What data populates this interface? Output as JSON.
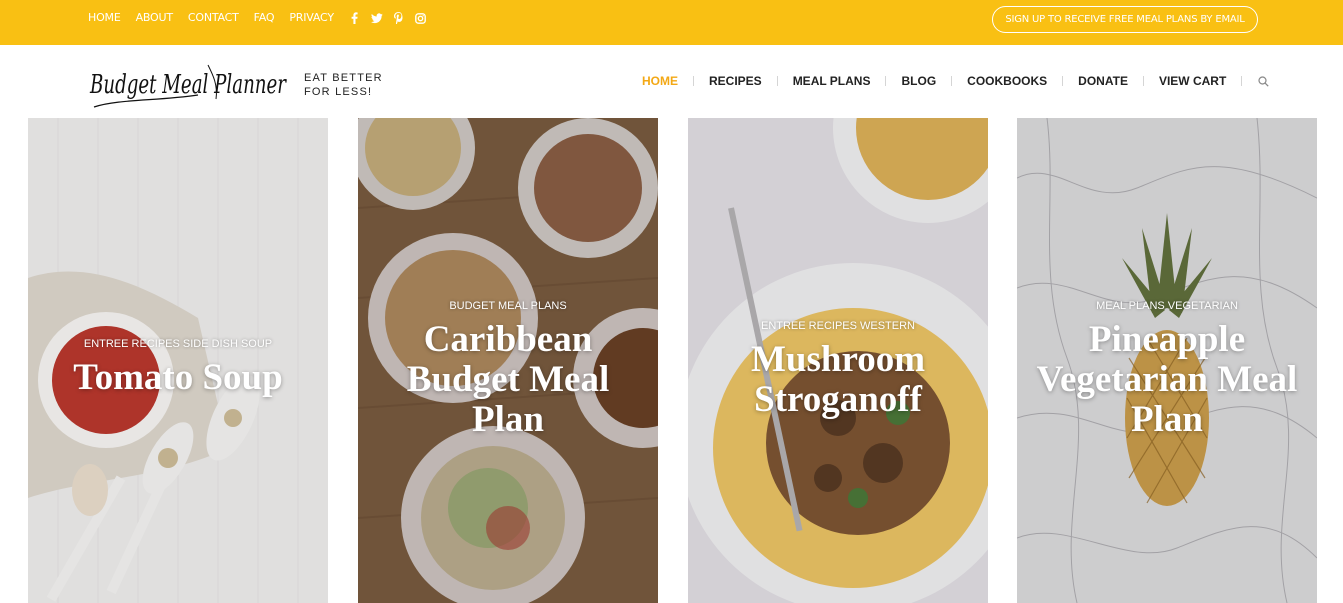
{
  "topbar": {
    "links": [
      "HOME",
      "ABOUT",
      "CONTACT",
      "FAQ",
      "PRIVACY"
    ],
    "social_icons": [
      "facebook-icon",
      "twitter-icon",
      "pinterest-icon",
      "instagram-icon"
    ],
    "signup_label": "SIGN UP TO RECEIVE FREE MEAL PLANS BY EMAIL",
    "color": "#f9c013"
  },
  "header": {
    "logo_text": "Budget Meal Planner",
    "tagline_line1": "EAT BETTER",
    "tagline_line2": "FOR LESS!",
    "nav": [
      "HOME",
      "RECIPES",
      "MEAL PLANS",
      "BLOG",
      "COOKBOOKS",
      "DONATE",
      "VIEW CART"
    ],
    "active_nav": "HOME",
    "active_color": "#f3a815",
    "search_icon": "search-icon"
  },
  "cards": [
    {
      "categories": "ENTREE RECIPES SIDE DISH SOUP",
      "title": "Tomato Soup"
    },
    {
      "categories": "BUDGET MEAL PLANS",
      "title": "Caribbean Budget Meal Plan"
    },
    {
      "categories": "ENTREE RECIPES WESTERN",
      "title": "Mushroom Stroganoff"
    },
    {
      "categories": "MEAL PLANS VEGETARIAN",
      "title": "Pineapple Vegetarian Meal Plan"
    }
  ]
}
